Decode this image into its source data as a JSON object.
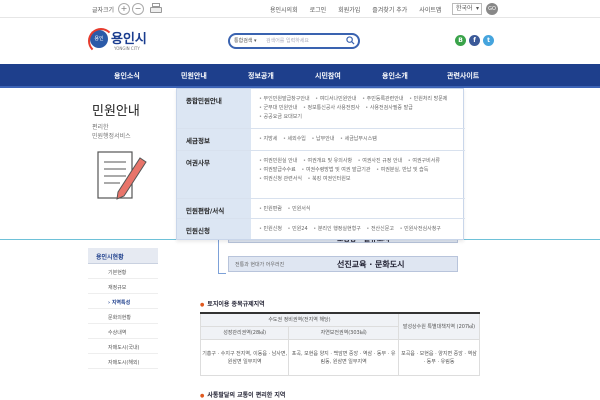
{
  "util": {
    "font_size_label": "글자크기",
    "zoom_in": "+",
    "zoom_out": "−",
    "links": [
      "용인시의회",
      "로그인",
      "회원가입",
      "즐겨찾기 추가",
      "사이트맵"
    ],
    "language": "한국어",
    "go": "GO"
  },
  "header": {
    "logo_name": "용인시",
    "logo_sub": "YONGIN CITY",
    "logo_emblem": "용인",
    "search_scope": "통합검색 ▾",
    "search_placeholder": "검색어를 입력하세요",
    "sns": [
      {
        "label": "B",
        "color": "#3aa34a"
      },
      {
        "label": "f",
        "color": "#3b5998"
      },
      {
        "label": "t",
        "color": "#45a4dd"
      }
    ]
  },
  "nav": {
    "items": [
      "용인소식",
      "민원안내",
      "정보공개",
      "시민참여",
      "용인소개",
      "관련사이트"
    ]
  },
  "side": {
    "title": "민원안내",
    "desc_line1": "편리한",
    "desc_line2": "민원행정서비스",
    "menu_head": "용인시현황",
    "menu_items": [
      "기본현황",
      "재정규모",
      "지역특성",
      "문화의현황",
      "수상내역",
      "자매도시(국내)",
      "자매도시(해외)"
    ],
    "menu_active": "지역특성"
  },
  "mega": {
    "rows": [
      {
        "category": "종합민원안내",
        "links": [
          "무인민원발급창구안내",
          "여디서나민원안내",
          "주민등록관련안내",
          "민원처리 방문제",
          "군부대 민원안내",
          "정보통신공사 사용전점사",
          "사용전검사필증 발급",
          "공공요금 요대보기"
        ]
      },
      {
        "category": "세금정보",
        "links": [
          "지방세",
          "세외수입",
          "납부안내",
          "세금납부시스템"
        ]
      },
      {
        "category": "여권사무",
        "links": [
          "여권민원실 안내",
          "여권개요 및 유의사항",
          "여권사진 규정 안내",
          "여권구비서류",
          "여권발급수수료",
          "여권수령방법 및 여권 발급기관",
          "여권분실, 반납 및 습득",
          "여권신청 관련서식",
          "북킹 여권인터원보"
        ]
      },
      {
        "category": "민원편람/서식",
        "links": [
          "민원편람",
          "민원서식"
        ]
      },
      {
        "category": "민원신청",
        "links": [
          "민원신청",
          "민원24",
          "분리인 행정실현형구",
          "전산신문고",
          "민원사전심사청구",
          "유"
        ]
      }
    ]
  },
  "content": {
    "diagram_top": "교통망 · 물류도시",
    "diagram_left": "전통과 현대가 어우러진",
    "diagram_right": "선진교육 · 문화도시",
    "section1": "토지이용 종목규제지역",
    "table_col1": "수도권 정비권역(전지역 해당)",
    "table_col2": "발성상수원 특별대책지역 (207㎢)",
    "table_sub1": "성장관리권역(28㎢)",
    "table_sub2": "자연보전권역(303㎢)",
    "cell1": "기흥구 · 수지구 전지역, 이동읍 · 남사면, 원삼면 일부지역",
    "cell2": "포곡, 모현읍 양지 · 백암면 중앙 · 역삼 · 동부 · 유림동, 원삼면 일부지역",
    "cell3": "포곡읍 · 모현읍 · 양지면 중앙 · 역삼 · 동부 · 유림동",
    "section2": "사통팔달의 교통이 편리한 지역"
  }
}
